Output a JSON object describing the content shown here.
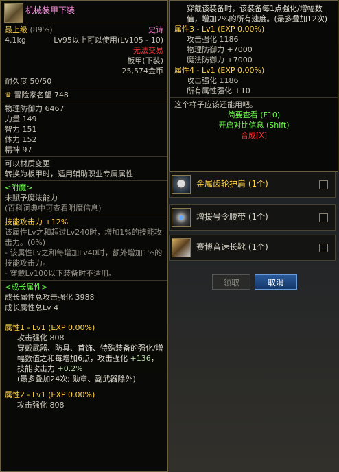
{
  "colors": {
    "title": "#ff9ae8",
    "label": "#ffd24a",
    "bonus": "#6cff4a",
    "grey": "#9a968c",
    "error": "#ff3030"
  },
  "left": {
    "title": "机械装甲下装",
    "icon": "armor-pants-icon",
    "grade_label": "最上级",
    "grade_pct": "(89%)",
    "rarity": "史诗",
    "weight": "4.1kg",
    "level_req": "Lv95以上可以使用(Lv105 - 10)",
    "trade": "无法交易",
    "slot": "板甲(下装)",
    "price": "25,574金币",
    "durability": "耐久度 50/50",
    "fame": "冒险家名望 748",
    "fame_icon": "fame-crown-icon",
    "stats": [
      {
        "name": "物理防御力",
        "value": "6467"
      },
      {
        "name": "力量",
        "value": "149"
      },
      {
        "name": "智力",
        "value": "151"
      },
      {
        "name": "体力",
        "value": "152"
      },
      {
        "name": "精神",
        "value": "97"
      }
    ],
    "transform_1": "可以材质变更",
    "transform_2": "转换为板甲时，适用辅助职业专属属性",
    "enchant_header": "<附魔>",
    "enchant_1": "未赋予魔法能力",
    "enchant_2": "(百科词典中可查看附魔信息)",
    "skill_1": "技能攻击力 +12%",
    "skill_2": "该属性Lv之和超过Lv240时，增加1%的技能攻击力。(0%)",
    "skill_3": "- 该属性Lv之和每增加Lv40时，额外增加1%的技能攻击力。",
    "skill_4": "- 穿戴Lv100以下装备时不适用。",
    "growth_header": "<成长属性>",
    "growth_1": "成长属性总攻击强化 3988",
    "growth_2": "成长属性总Lv 4",
    "attr1_title": "属性1 - Lv1 (EXP 0.00%)",
    "attr1_atk": "攻击强化 808",
    "attr1_d1": "穿戴武器、防具、首饰、特殊装备的强化/增幅数值之和每增加6点，攻击强化",
    "attr1_d2": "+136",
    "attr1_d3": "，技能攻击力",
    "attr1_d4": "+0.2%",
    "attr1_d5": "(最多叠加24次; 勋章、副武器除外)",
    "attr2_title": "属性2 - Lv1 (EXP 0.00%)",
    "attr2_atk": "攻击强化 808"
  },
  "right": {
    "intro": "穿戴该装备时，该装备每1点强化/增幅数值，增加2%的所有速度。(最多叠加12次)",
    "attr3_title": "属性3 - Lv1 (EXP 0.00%)",
    "attr3_lines": [
      "攻击强化 1186",
      "物理防御力 +7000",
      "魔法防御力 +7000"
    ],
    "attr4_title": "属性4 - Lv1 (EXP 0.00%)",
    "attr4_lines": [
      "攻击强化 1186",
      "所有属性强化 +10"
    ],
    "comment": "这个样子应该还能用吧。",
    "brief": "简要查看 (F10)",
    "compare": "开启对比信息 (Shift)",
    "synth": "合成[X]"
  },
  "rewards": [
    {
      "label": "金属齿轮护肩 (1个)",
      "icon": "gear-shoulder-icon"
    },
    {
      "label": "增援号令腰带 (1个)",
      "icon": "belt-icon"
    },
    {
      "label": "赛博音速长靴 (1个)",
      "icon": "boots-icon"
    }
  ],
  "buttons": {
    "receive": "领取",
    "cancel": "取消"
  }
}
